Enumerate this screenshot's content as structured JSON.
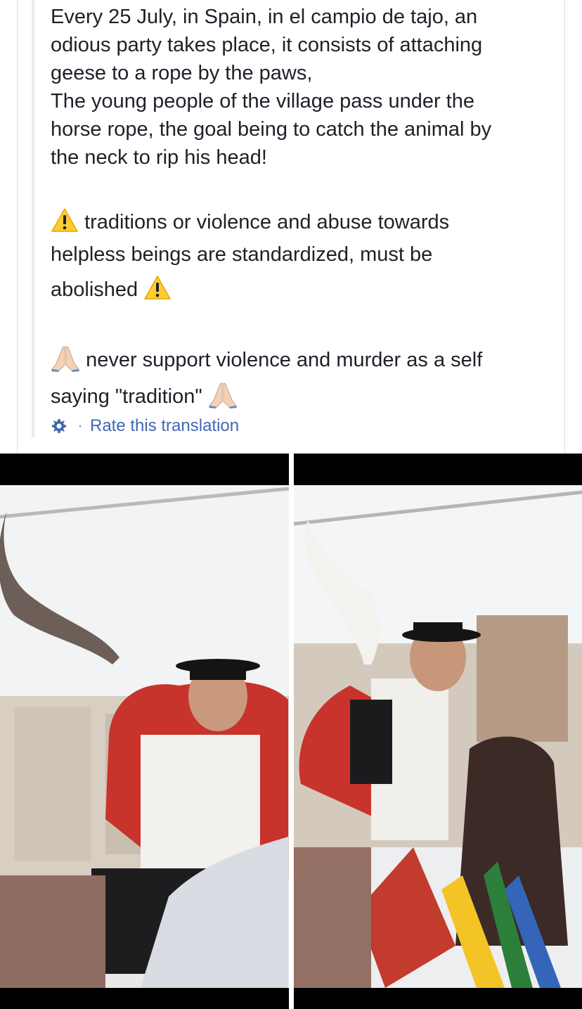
{
  "post": {
    "paragraph1": [
      "Every 25 July, in Spain, in el campio de tajo, an",
      "odious party takes place, it consists of attaching",
      "geese to a rope by the paws,",
      "The young people of the village pass under the",
      "horse rope, the goal being to catch the animal by",
      "the neck to rip his head!"
    ],
    "paragraph2_line1": "traditions or violence and abuse towards",
    "paragraph2_line2": "helpless beings are standardized, must be",
    "paragraph2_line3": "abolished",
    "paragraph3_line1": "never support violence and murder as a self",
    "paragraph3_line2": "saying \"tradition\""
  },
  "translation": {
    "separator": "·",
    "rate_label": "Rate this translation"
  },
  "icons": {
    "warning": "warning-icon",
    "pray": "folded-hands-icon",
    "gear": "gear-icon"
  },
  "colors": {
    "text": "#1d2129",
    "link": "#4267b2",
    "warning": "#ffcc33"
  }
}
